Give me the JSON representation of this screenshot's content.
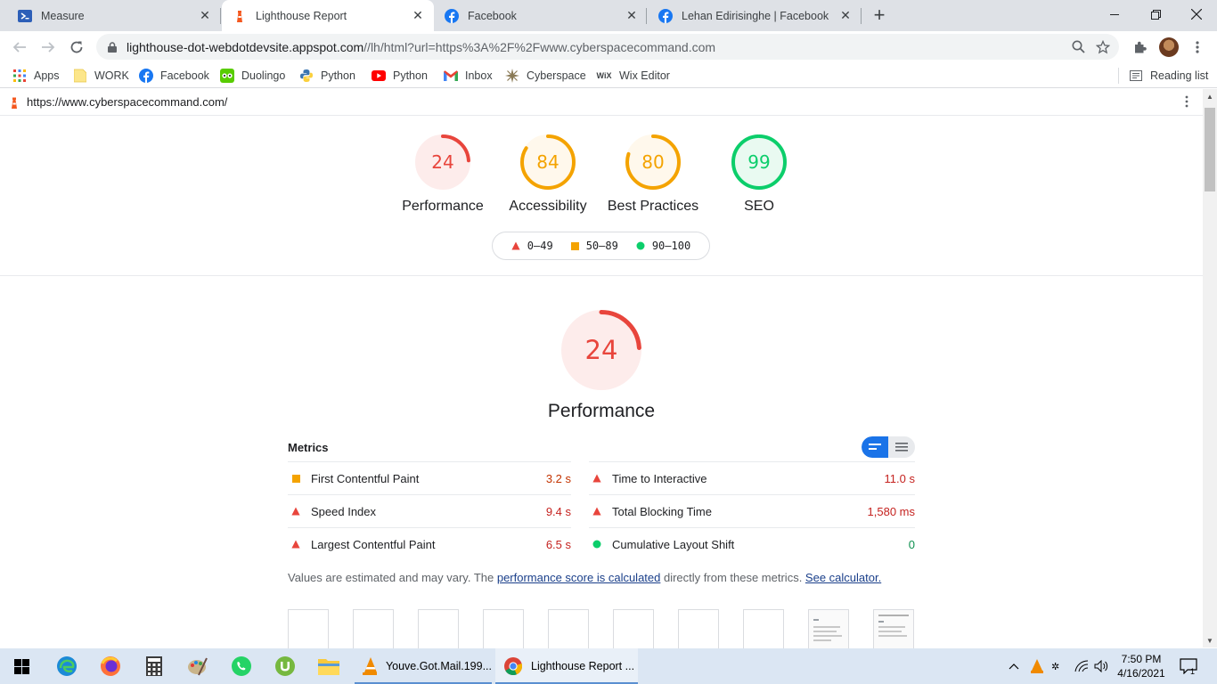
{
  "browser": {
    "tabs": [
      {
        "title": "Measure",
        "active": false
      },
      {
        "title": "Lighthouse Report",
        "active": true
      },
      {
        "title": "Facebook",
        "active": false
      },
      {
        "title": "Lehan Edirisinghe | Facebook",
        "active": false
      }
    ],
    "url_host": "lighthouse-dot-webdotdevsite.appspot.com",
    "url_path": "//lh/html?url=https%3A%2F%2Fwww.cyberspacecommand.com",
    "bookmarks": [
      "Apps",
      "WORK",
      "Facebook",
      "Duolingo",
      "Python",
      "Python",
      "Inbox",
      "Cyberspace",
      "Wix Editor"
    ],
    "reading_list": "Reading list"
  },
  "report": {
    "url": "https://www.cyberspacecommand.com/",
    "gauges": [
      {
        "score": "24",
        "label": "Performance",
        "value": 24,
        "color": "#e8453c",
        "bg": "#fdeceb"
      },
      {
        "score": "84",
        "label": "Accessibility",
        "value": 84,
        "color": "#f4a300",
        "bg": "#fff8ec"
      },
      {
        "score": "80",
        "label": "Best Practices",
        "value": 80,
        "color": "#f4a300",
        "bg": "#fff8ec"
      },
      {
        "score": "99",
        "label": "SEO",
        "value": 99,
        "color": "#0cce6b",
        "bg": "#e9faf1"
      }
    ],
    "legend": [
      "0–49",
      "50–89",
      "90–100"
    ],
    "performance": {
      "score": "24",
      "value": 24,
      "label": "Performance"
    },
    "metrics_title": "Metrics",
    "metrics": [
      {
        "name": "First Contentful Paint",
        "value": "3.2 s",
        "status": "average"
      },
      {
        "name": "Time to Interactive",
        "value": "11.0 s",
        "status": "fail"
      },
      {
        "name": "Speed Index",
        "value": "9.4 s",
        "status": "fail"
      },
      {
        "name": "Total Blocking Time",
        "value": "1,580 ms",
        "status": "fail"
      },
      {
        "name": "Largest Contentful Paint",
        "value": "6.5 s",
        "status": "fail"
      },
      {
        "name": "Cumulative Layout Shift",
        "value": "0",
        "status": "pass"
      }
    ],
    "note_prefix": "Values are estimated and may vary. The ",
    "note_link1": "performance score is calculated",
    "note_middle": " directly from these metrics. ",
    "note_link2": "See calculator."
  },
  "taskbar": {
    "apps": [
      {
        "title": "Youve.Got.Mail.199...",
        "active": false
      },
      {
        "title": "Lighthouse Report ...",
        "active": true
      }
    ],
    "time": "7:50 PM",
    "date": "4/16/2021",
    "notification_count": "1"
  },
  "colors": {
    "fail": "#e8453c",
    "average": "#f4a300",
    "pass": "#0cce6b",
    "accent": "#1a73e8"
  }
}
